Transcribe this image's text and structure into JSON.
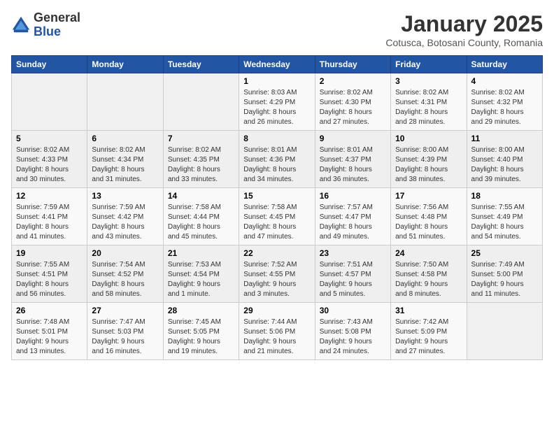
{
  "header": {
    "logo": {
      "line1": "General",
      "line2": "Blue"
    },
    "title": "January 2025",
    "subtitle": "Cotusca, Botosani County, Romania"
  },
  "calendar": {
    "weekdays": [
      "Sunday",
      "Monday",
      "Tuesday",
      "Wednesday",
      "Thursday",
      "Friday",
      "Saturday"
    ],
    "weeks": [
      [
        {
          "day": "",
          "info": ""
        },
        {
          "day": "",
          "info": ""
        },
        {
          "day": "",
          "info": ""
        },
        {
          "day": "1",
          "info": "Sunrise: 8:03 AM\nSunset: 4:29 PM\nDaylight: 8 hours\nand 26 minutes."
        },
        {
          "day": "2",
          "info": "Sunrise: 8:02 AM\nSunset: 4:30 PM\nDaylight: 8 hours\nand 27 minutes."
        },
        {
          "day": "3",
          "info": "Sunrise: 8:02 AM\nSunset: 4:31 PM\nDaylight: 8 hours\nand 28 minutes."
        },
        {
          "day": "4",
          "info": "Sunrise: 8:02 AM\nSunset: 4:32 PM\nDaylight: 8 hours\nand 29 minutes."
        }
      ],
      [
        {
          "day": "5",
          "info": "Sunrise: 8:02 AM\nSunset: 4:33 PM\nDaylight: 8 hours\nand 30 minutes."
        },
        {
          "day": "6",
          "info": "Sunrise: 8:02 AM\nSunset: 4:34 PM\nDaylight: 8 hours\nand 31 minutes."
        },
        {
          "day": "7",
          "info": "Sunrise: 8:02 AM\nSunset: 4:35 PM\nDaylight: 8 hours\nand 33 minutes."
        },
        {
          "day": "8",
          "info": "Sunrise: 8:01 AM\nSunset: 4:36 PM\nDaylight: 8 hours\nand 34 minutes."
        },
        {
          "day": "9",
          "info": "Sunrise: 8:01 AM\nSunset: 4:37 PM\nDaylight: 8 hours\nand 36 minutes."
        },
        {
          "day": "10",
          "info": "Sunrise: 8:00 AM\nSunset: 4:39 PM\nDaylight: 8 hours\nand 38 minutes."
        },
        {
          "day": "11",
          "info": "Sunrise: 8:00 AM\nSunset: 4:40 PM\nDaylight: 8 hours\nand 39 minutes."
        }
      ],
      [
        {
          "day": "12",
          "info": "Sunrise: 7:59 AM\nSunset: 4:41 PM\nDaylight: 8 hours\nand 41 minutes."
        },
        {
          "day": "13",
          "info": "Sunrise: 7:59 AM\nSunset: 4:42 PM\nDaylight: 8 hours\nand 43 minutes."
        },
        {
          "day": "14",
          "info": "Sunrise: 7:58 AM\nSunset: 4:44 PM\nDaylight: 8 hours\nand 45 minutes."
        },
        {
          "day": "15",
          "info": "Sunrise: 7:58 AM\nSunset: 4:45 PM\nDaylight: 8 hours\nand 47 minutes."
        },
        {
          "day": "16",
          "info": "Sunrise: 7:57 AM\nSunset: 4:47 PM\nDaylight: 8 hours\nand 49 minutes."
        },
        {
          "day": "17",
          "info": "Sunrise: 7:56 AM\nSunset: 4:48 PM\nDaylight: 8 hours\nand 51 minutes."
        },
        {
          "day": "18",
          "info": "Sunrise: 7:55 AM\nSunset: 4:49 PM\nDaylight: 8 hours\nand 54 minutes."
        }
      ],
      [
        {
          "day": "19",
          "info": "Sunrise: 7:55 AM\nSunset: 4:51 PM\nDaylight: 8 hours\nand 56 minutes."
        },
        {
          "day": "20",
          "info": "Sunrise: 7:54 AM\nSunset: 4:52 PM\nDaylight: 8 hours\nand 58 minutes."
        },
        {
          "day": "21",
          "info": "Sunrise: 7:53 AM\nSunset: 4:54 PM\nDaylight: 9 hours\nand 1 minute."
        },
        {
          "day": "22",
          "info": "Sunrise: 7:52 AM\nSunset: 4:55 PM\nDaylight: 9 hours\nand 3 minutes."
        },
        {
          "day": "23",
          "info": "Sunrise: 7:51 AM\nSunset: 4:57 PM\nDaylight: 9 hours\nand 5 minutes."
        },
        {
          "day": "24",
          "info": "Sunrise: 7:50 AM\nSunset: 4:58 PM\nDaylight: 9 hours\nand 8 minutes."
        },
        {
          "day": "25",
          "info": "Sunrise: 7:49 AM\nSunset: 5:00 PM\nDaylight: 9 hours\nand 11 minutes."
        }
      ],
      [
        {
          "day": "26",
          "info": "Sunrise: 7:48 AM\nSunset: 5:01 PM\nDaylight: 9 hours\nand 13 minutes."
        },
        {
          "day": "27",
          "info": "Sunrise: 7:47 AM\nSunset: 5:03 PM\nDaylight: 9 hours\nand 16 minutes."
        },
        {
          "day": "28",
          "info": "Sunrise: 7:45 AM\nSunset: 5:05 PM\nDaylight: 9 hours\nand 19 minutes."
        },
        {
          "day": "29",
          "info": "Sunrise: 7:44 AM\nSunset: 5:06 PM\nDaylight: 9 hours\nand 21 minutes."
        },
        {
          "day": "30",
          "info": "Sunrise: 7:43 AM\nSunset: 5:08 PM\nDaylight: 9 hours\nand 24 minutes."
        },
        {
          "day": "31",
          "info": "Sunrise: 7:42 AM\nSunset: 5:09 PM\nDaylight: 9 hours\nand 27 minutes."
        },
        {
          "day": "",
          "info": ""
        }
      ]
    ]
  }
}
